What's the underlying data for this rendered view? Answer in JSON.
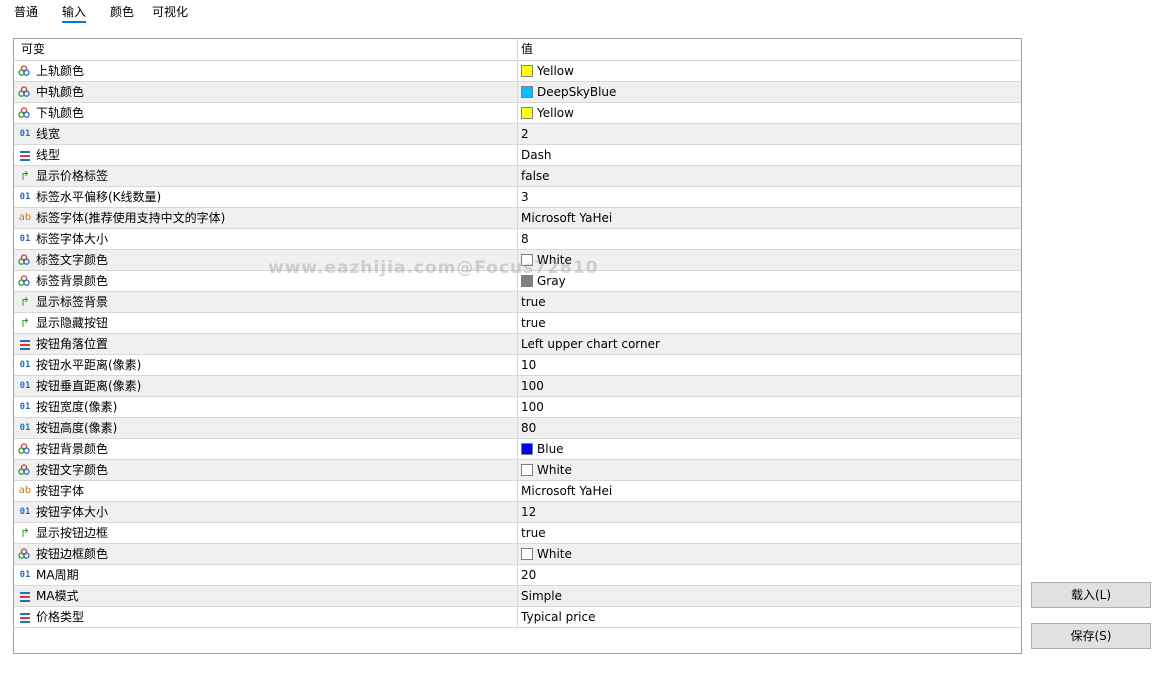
{
  "tabs": [
    {
      "label": "普通"
    },
    {
      "label": "输入"
    },
    {
      "label": "颜色"
    },
    {
      "label": "可视化"
    }
  ],
  "grid": {
    "header": {
      "name": "可变",
      "value": "值"
    },
    "rows": [
      {
        "icon": "color",
        "name": "上轨颜色",
        "value": "Yellow",
        "swatch": "#ffff00"
      },
      {
        "icon": "color",
        "name": "中轨颜色",
        "value": "DeepSkyBlue",
        "swatch": "#00bfff"
      },
      {
        "icon": "color",
        "name": "下轨颜色",
        "value": "Yellow",
        "swatch": "#ffff00"
      },
      {
        "icon": "int",
        "name": "线宽",
        "value": "2"
      },
      {
        "icon": "enum",
        "name": "线型",
        "value": "Dash"
      },
      {
        "icon": "bool",
        "name": "显示价格标签",
        "value": "false"
      },
      {
        "icon": "int",
        "name": "标签水平偏移(K线数量)",
        "value": "3"
      },
      {
        "icon": "str",
        "name": "标签字体(推荐使用支持中文的字体)",
        "value": "Microsoft YaHei"
      },
      {
        "icon": "int",
        "name": "标签字体大小",
        "value": "8"
      },
      {
        "icon": "color",
        "name": "标签文字颜色",
        "value": "White",
        "swatch": "#ffffff"
      },
      {
        "icon": "color",
        "name": "标签背景颜色",
        "value": "Gray",
        "swatch": "#808080"
      },
      {
        "icon": "bool",
        "name": "显示标签背景",
        "value": "true"
      },
      {
        "icon": "bool",
        "name": "显示隐藏按钮",
        "value": "true"
      },
      {
        "icon": "enum",
        "name": "按钮角落位置",
        "value": "Left upper chart corner"
      },
      {
        "icon": "int",
        "name": "按钮水平距离(像素)",
        "value": "10"
      },
      {
        "icon": "int",
        "name": "按钮垂直距离(像素)",
        "value": "100"
      },
      {
        "icon": "int",
        "name": "按钮宽度(像素)",
        "value": "100"
      },
      {
        "icon": "int",
        "name": "按钮高度(像素)",
        "value": "80"
      },
      {
        "icon": "color",
        "name": "按钮背景颜色",
        "value": "Blue",
        "swatch": "#0000ff"
      },
      {
        "icon": "color",
        "name": "按钮文字颜色",
        "value": "White",
        "swatch": "#ffffff"
      },
      {
        "icon": "str",
        "name": "按钮字体",
        "value": "Microsoft YaHei"
      },
      {
        "icon": "int",
        "name": "按钮字体大小",
        "value": "12"
      },
      {
        "icon": "bool",
        "name": "显示按钮边框",
        "value": "true"
      },
      {
        "icon": "color",
        "name": "按钮边框颜色",
        "value": "White",
        "swatch": "#ffffff"
      },
      {
        "icon": "int",
        "name": "MA周期",
        "value": "20"
      },
      {
        "icon": "enum",
        "name": "MA模式",
        "value": "Simple"
      },
      {
        "icon": "enum",
        "name": "价格类型",
        "value": "Typical price"
      }
    ]
  },
  "watermark": "www.eazhijia.com@Focus72810",
  "buttons": {
    "load": "载入(L)",
    "save": "保存(S)"
  },
  "icon_glyphs": {
    "int": "01",
    "str": "ab",
    "bool": "↱"
  }
}
